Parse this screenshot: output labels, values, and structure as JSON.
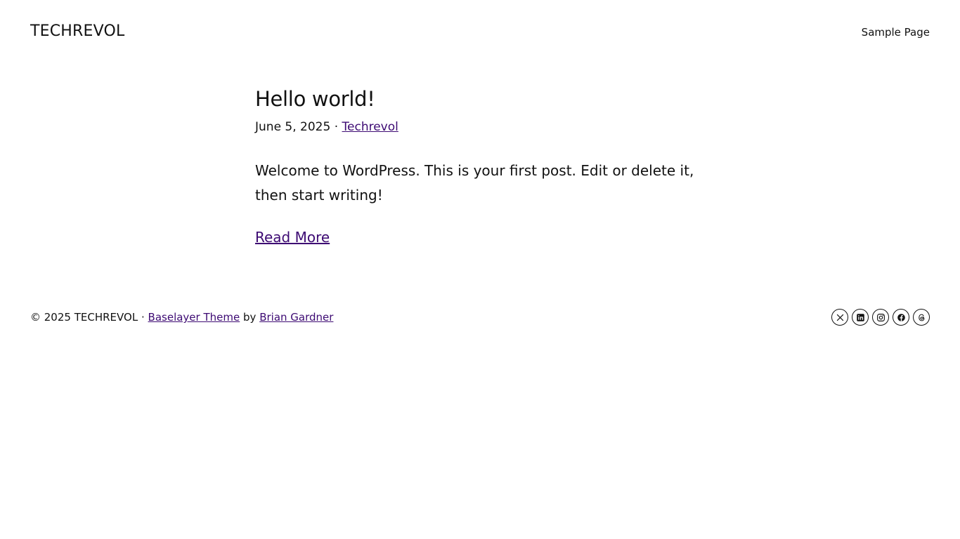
{
  "header": {
    "site_title": "TECHREVOL",
    "nav": [
      {
        "label": "Sample Page"
      }
    ]
  },
  "post": {
    "title": "Hello world!",
    "date": "June 5, 2025",
    "separator": "·",
    "author": "Techrevol",
    "excerpt": "Welcome to WordPress. This is your first post. Edit or delete it, then start writing!",
    "read_more": "Read More"
  },
  "footer": {
    "copyright": "© 2025",
    "site_name": "TECHREVOL",
    "separator": "·",
    "theme_link": "Baselayer Theme",
    "by": "by",
    "author_link": "Brian Gardner",
    "social": [
      {
        "icon": "x-twitter-icon"
      },
      {
        "icon": "linkedin-icon"
      },
      {
        "icon": "instagram-icon"
      },
      {
        "icon": "facebook-icon"
      },
      {
        "icon": "threads-icon"
      }
    ]
  },
  "colors": {
    "text": "#111111",
    "link": "#3d0a73",
    "background": "#ffffff"
  }
}
